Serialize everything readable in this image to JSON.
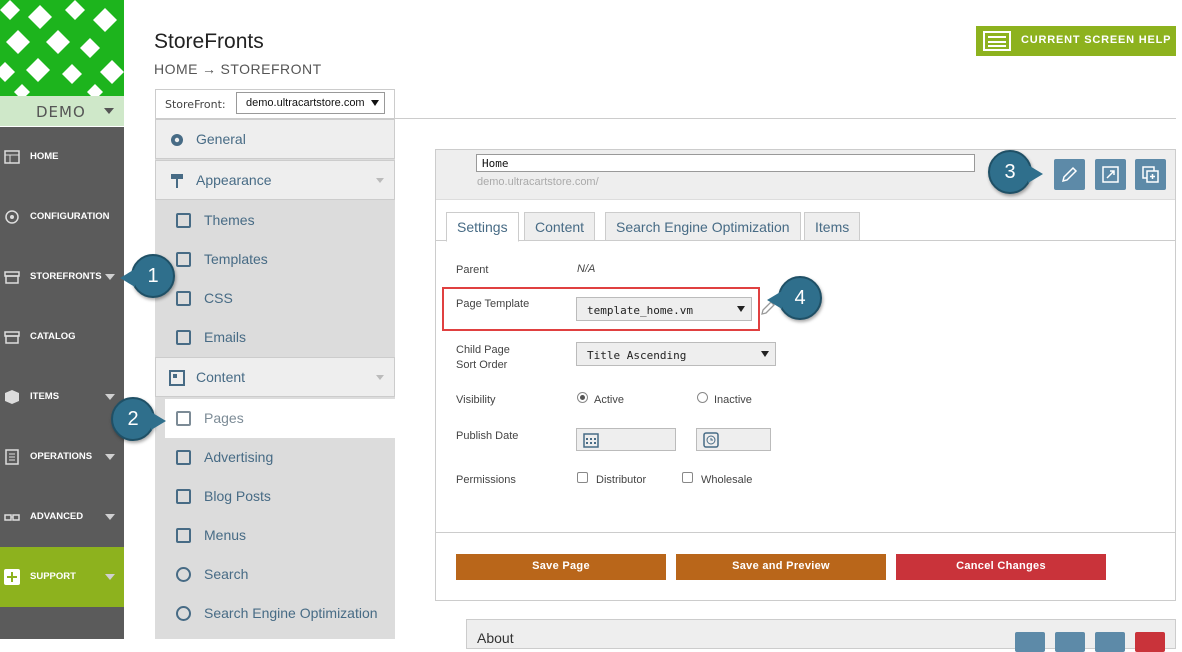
{
  "brand": {
    "env_label": "DEMO"
  },
  "nav": {
    "items": [
      {
        "label": "HOME",
        "icon": "home-icon"
      },
      {
        "label": "CONFIGURATION",
        "icon": "gear-icon"
      },
      {
        "label": "STOREFRONTS",
        "icon": "storefront-icon"
      },
      {
        "label": "CATALOG",
        "icon": "catalog-icon"
      },
      {
        "label": "ITEMS",
        "icon": "box-icon"
      },
      {
        "label": "OPERATIONS",
        "icon": "operations-icon"
      },
      {
        "label": "ADVANCED",
        "icon": "glasses-icon"
      },
      {
        "label": "SUPPORT",
        "icon": "plus-icon"
      }
    ]
  },
  "header": {
    "title": "StoreFronts",
    "breadcrumb": [
      "HOME",
      "→",
      "STOREFRONT"
    ],
    "help_button": "CURRENT SCREEN HELP"
  },
  "storefront_select": {
    "label": "StoreFront:",
    "value": "demo.ultracartstore.com"
  },
  "submenu": {
    "general": "General",
    "appearance": "Appearance",
    "themes": "Themes",
    "templates": "Templates",
    "css": "CSS",
    "emails": "Emails",
    "content": "Content",
    "pages": "Pages",
    "advertising": "Advertising",
    "blog_posts": "Blog Posts",
    "menus": "Menus",
    "search": "Search",
    "seo": "Search Engine Optimization"
  },
  "page_editor": {
    "page_name": "Home",
    "page_url": "demo.ultracartstore.com/",
    "tabs": [
      "Settings",
      "Content",
      "Search Engine Optimization",
      "Items"
    ],
    "fields": {
      "parent_label": "Parent",
      "parent_value": "N/A",
      "template_label": "Page Template",
      "template_value": "template_home.vm",
      "child_sort_label_1": "Child Page",
      "child_sort_label_2": "Sort Order",
      "child_sort_value": "Title Ascending",
      "visibility_label": "Visibility",
      "visibility_active": "Active",
      "visibility_inactive": "Inactive",
      "publish_date_label": "Publish Date",
      "permissions_label": "Permissions",
      "perm_distributor": "Distributor",
      "perm_wholesale": "Wholesale"
    },
    "actions": {
      "save": "Save Page",
      "preview": "Save and Preview",
      "cancel": "Cancel Changes"
    },
    "about_label": "About"
  },
  "callouts": [
    "1",
    "2",
    "3",
    "4"
  ],
  "colors": {
    "nav_bg": "#5b5b5b",
    "accent_green": "#8db21e",
    "link_blue": "#476b85",
    "save_orange": "#b9661a",
    "cancel_red": "#c9333a",
    "callout": "#2f6f8c"
  }
}
